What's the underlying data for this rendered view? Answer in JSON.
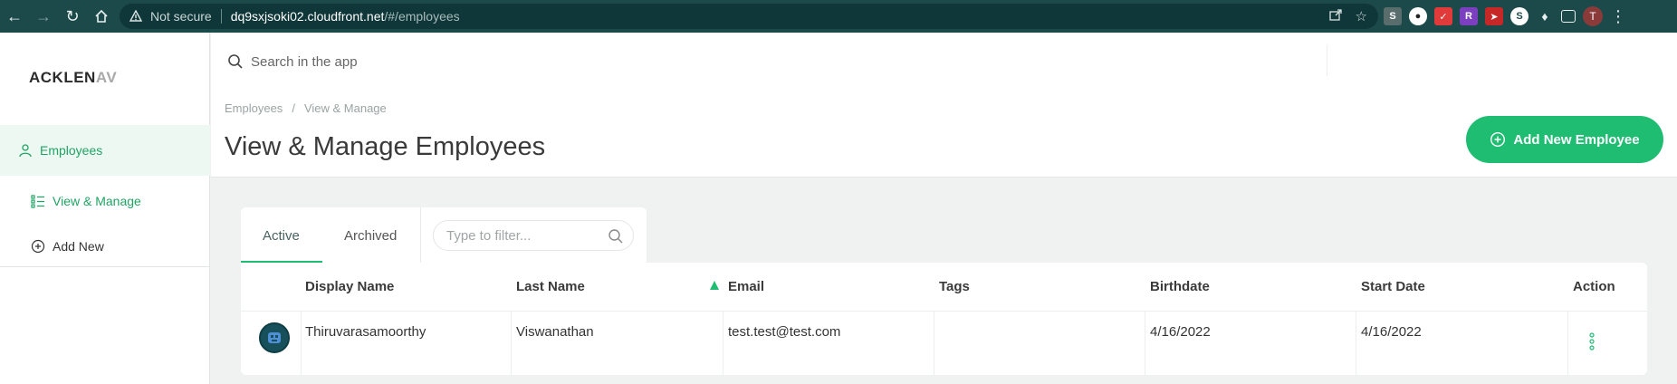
{
  "browser": {
    "not_secure": "Not secure",
    "url_host": "dq9sxjsoki02.cloudfront.net",
    "url_path": "/#/employees",
    "profile_initial": "T"
  },
  "sidebar": {
    "logo_main": "ACKLEN",
    "logo_fade": "AV",
    "section_label": "Employees",
    "items": [
      {
        "label": "View & Manage"
      },
      {
        "label": "Add New"
      }
    ]
  },
  "header": {
    "search_placeholder": "Search in the app",
    "breadcrumb": [
      "Employees",
      "/",
      "View & Manage"
    ],
    "title": "View & Manage Employees",
    "add_button": "Add New Employee"
  },
  "tabs": {
    "active": "Active",
    "archived": "Archived",
    "filter_placeholder": "Type to filter..."
  },
  "table": {
    "columns": [
      "Display Name",
      "Last Name",
      "Email",
      "Tags",
      "Birthdate",
      "Start Date",
      "Action"
    ],
    "rows": [
      {
        "display_name": "Thiruvarasamoorthy",
        "last_name": "Viswanathan",
        "email": "test.test@test.com",
        "tags": "",
        "birthdate": "4/16/2022",
        "start_date": "4/16/2022"
      }
    ]
  },
  "colors": {
    "accent": "#1fbd72",
    "chrome": "#1c4a4b"
  }
}
